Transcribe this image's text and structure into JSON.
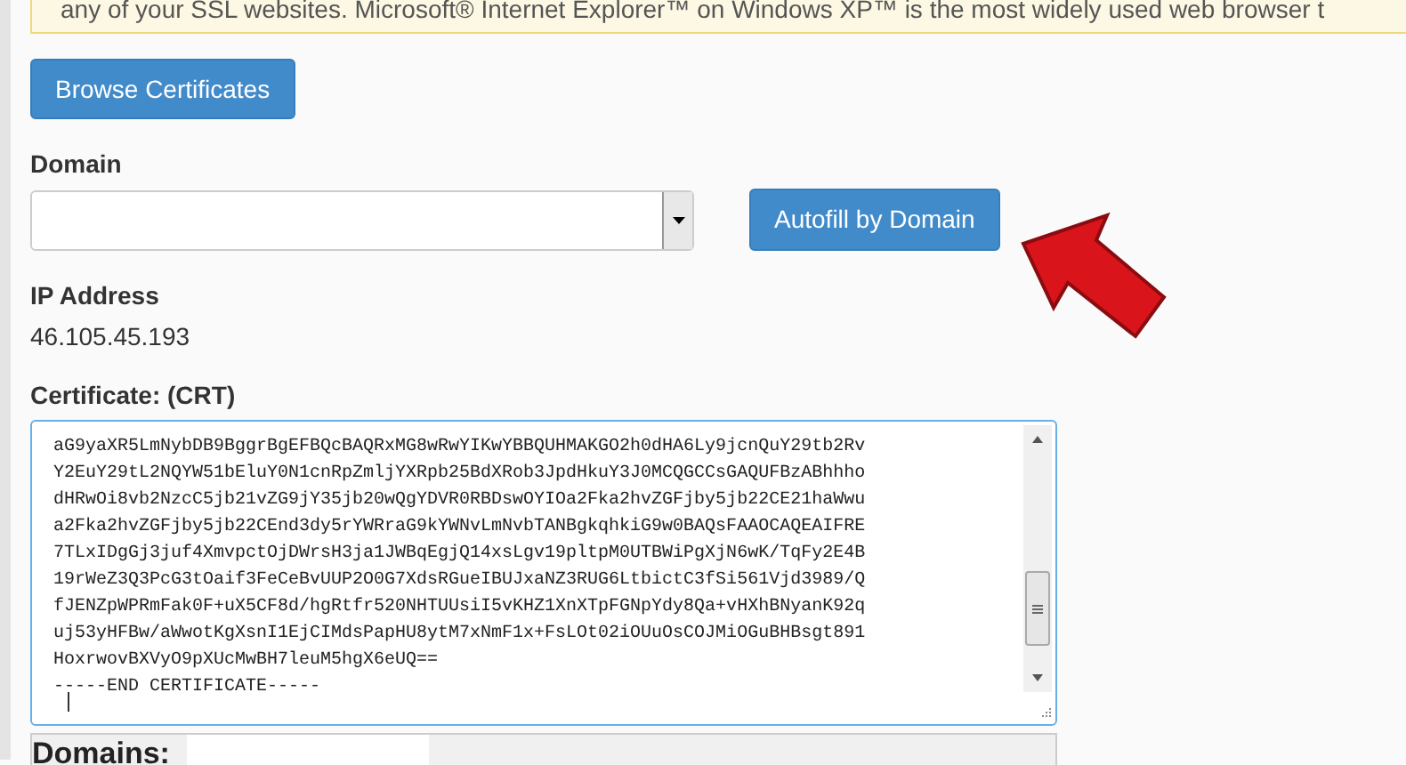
{
  "notice": {
    "text": "any of your SSL websites. Microsoft® Internet Explorer™ on Windows XP™ is the most widely used web browser t"
  },
  "browse_button": {
    "label": "Browse Certificates"
  },
  "domain": {
    "label": "Domain"
  },
  "autofill_button": {
    "label": "Autofill by Domain"
  },
  "ip_address": {
    "label": "IP Address",
    "value": "46.105.45.193"
  },
  "certificate": {
    "label": "Certificate: (CRT)",
    "lines": [
      "aG9yaXR5LmNybDB9BggrBgEFBQcBAQRxMG8wRwYIKwYBBQUHMAKGO2h0dHA6Ly9jcnQuY29tb2Rv",
      "Y2EuY29tL2NQYW51bEluY0N1cnRpZmljYXRpb25BdXRob3JpdHkuY3J0MCQGCCsGAQUFBzABhhho",
      "dHRwOi8vb2NzcC5jb21vZG9jY35jb20wQgYDVR0RBDswOYIOa2Fka2hvZGFjby5jb22CE21haWwu",
      "a2Fka2hvZGFjby5jb22CEnd3dy5rYWRraG9kYWNvLmNvbTANBgkqhkiG9w0BAQsFAAOCAQEAIFRE",
      "7TLxIDgGj3juf4XmvpctOjDWrsH3ja1JWBqEgjQ14xsLgv19pltpM0UTBWiPgXjN6wK/TqFy2E4B",
      "19rWeZ3Q3PcG3tOaif3FeCeBvUUP2O0G7XdsRGueIBUJxaNZ3RUG6LtbictC3fSi561Vjd3989/Q",
      "fJENZpWPRmFak0F+uX5CF8d/hgRtfr520NHTUUsiI5vKHZ1XnXTpFGNpYdy8Qa+vHXhBNyanK92q",
      "uj53yHFBw/aWwotKgXsnI1EjCIMdsPapHU8ytM7xNmF1x+FsLOt02iOUuOsCOJMiOGuBHBsgt891",
      "HoxrwovBXVyO9pXUcMwBH7leuM5hgX6eUQ==",
      "-----END CERTIFICATE-----"
    ]
  },
  "domains": {
    "label": "Domains:"
  }
}
